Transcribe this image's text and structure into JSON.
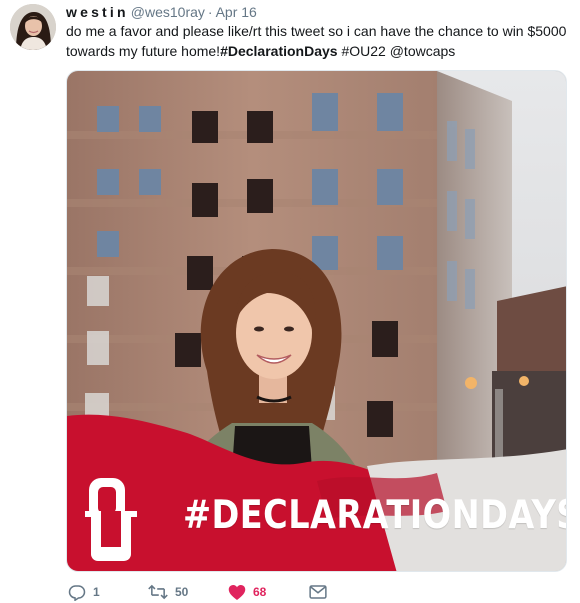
{
  "tweet": {
    "author": {
      "display_name": "westin",
      "handle": "@wes10ray"
    },
    "separator": "·",
    "timestamp": "Apr 16",
    "text_parts": {
      "before": "do me a favor and please like/rt this tweet so i can have the chance to win $5000 towards my future home!",
      "hashtag_bold": "#DeclarationDays",
      "after": " #OU22 @towcaps"
    },
    "media": {
      "banner_text": "#DECLARATIONDAYS",
      "logo": "OU",
      "banner_color": "#c8102e"
    },
    "actions": {
      "reply": {
        "icon": "reply-icon",
        "count": "1"
      },
      "retweet": {
        "icon": "retweet-icon",
        "count": "50"
      },
      "like": {
        "icon": "heart-icon",
        "count": "68",
        "color": "#e0245e"
      },
      "dm": {
        "icon": "envelope-icon"
      }
    }
  }
}
